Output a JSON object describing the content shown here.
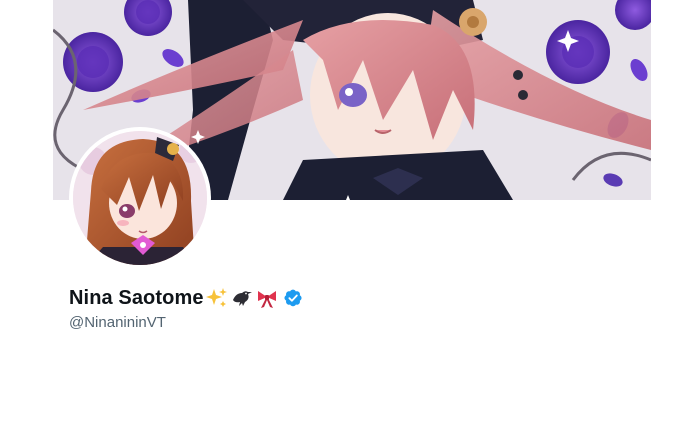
{
  "profile": {
    "display_name": "Nina Saotome",
    "emojis": [
      "sparkles-emoji",
      "crow-emoji",
      "ribbon-emoji"
    ],
    "verified": true,
    "handle": "@NinanininVT"
  },
  "colors": {
    "name_text": "#0f1419",
    "handle_text": "#536471",
    "verified_badge": "#1d9bf0",
    "background": "#ffffff"
  },
  "icons": {
    "verified": "verified-badge-icon"
  }
}
